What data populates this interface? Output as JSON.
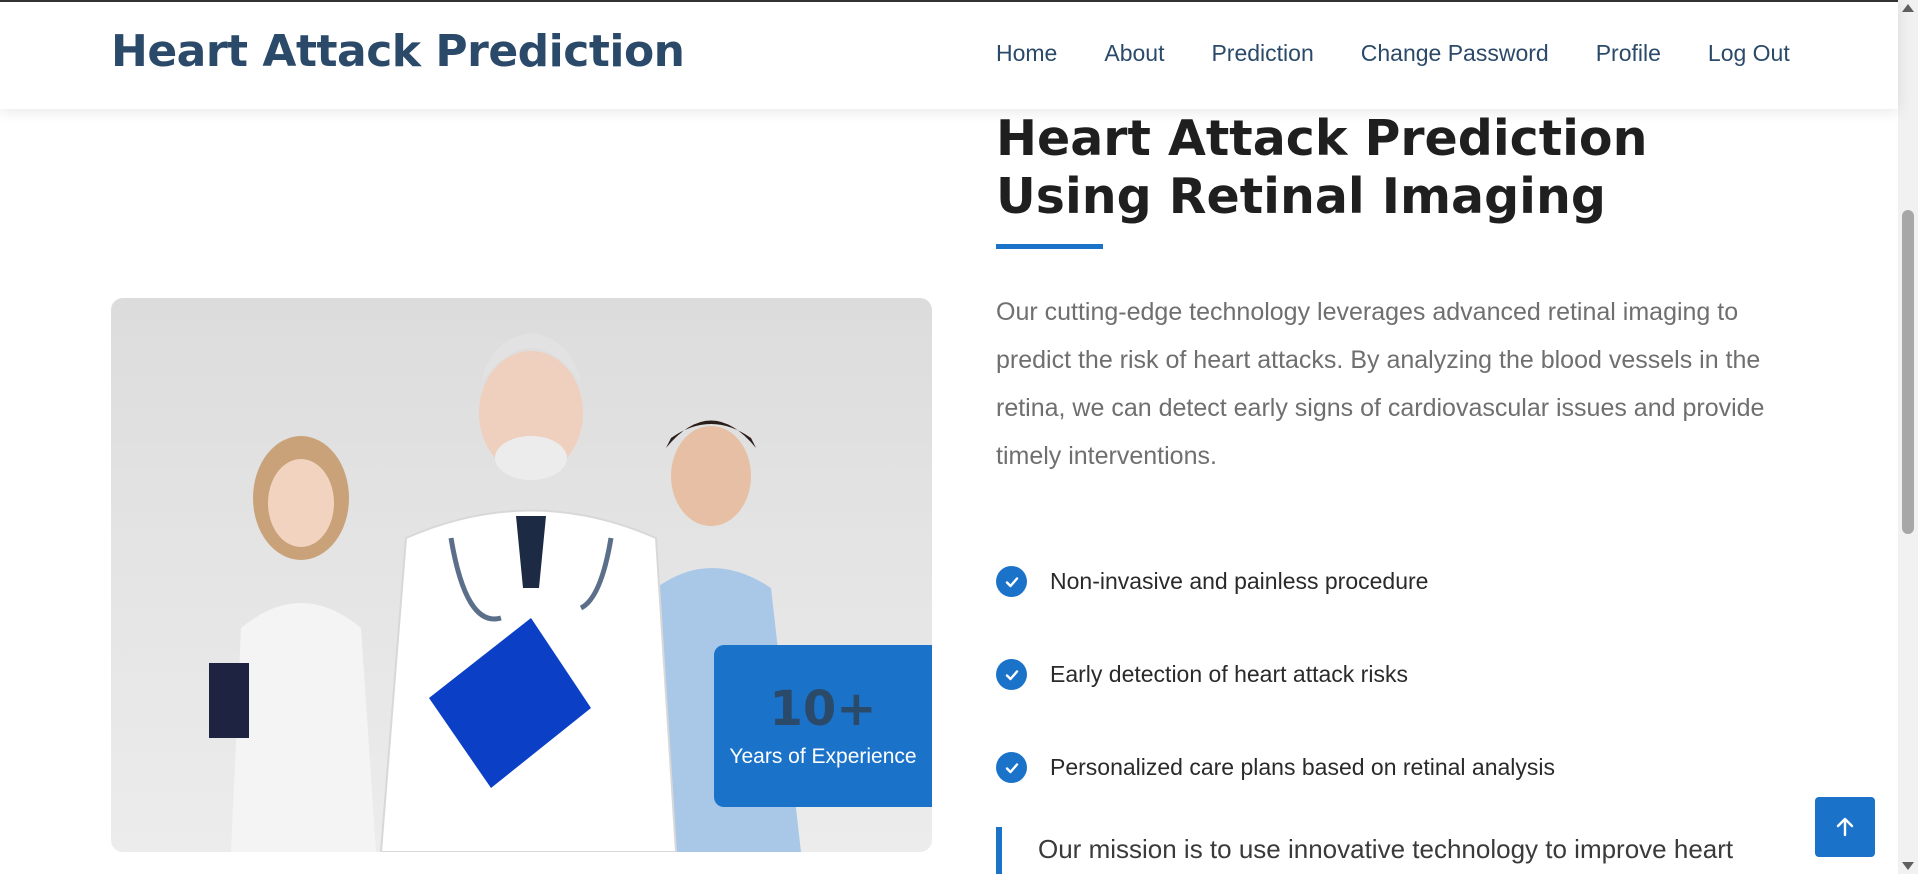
{
  "header": {
    "brand": "Heart Attack Prediction",
    "nav": [
      "Home",
      "About",
      "Prediction",
      "Change Password",
      "Profile",
      "Log Out"
    ]
  },
  "hero": {
    "title": "Heart Attack Prediction Using Retinal Imaging",
    "description": "Our cutting-edge technology leverages advanced retinal imaging to predict the risk of heart attacks. By analyzing the blood vessels in the retina, we can detect early signs of cardiovascular issues and provide timely interventions.",
    "features": [
      "Non-invasive and painless procedure",
      "Early detection of heart attack risks",
      "Personalized care plans based on retinal analysis"
    ],
    "mission": "Our mission is to use innovative technology to improve heart"
  },
  "experience": {
    "number": "10+",
    "label": "Years of Experience"
  },
  "icons": {
    "check": "check-circle-icon",
    "back_to_top": "arrow-up-icon"
  },
  "colors": {
    "accent": "#1b73c9",
    "brand": "#2b4a6a"
  }
}
